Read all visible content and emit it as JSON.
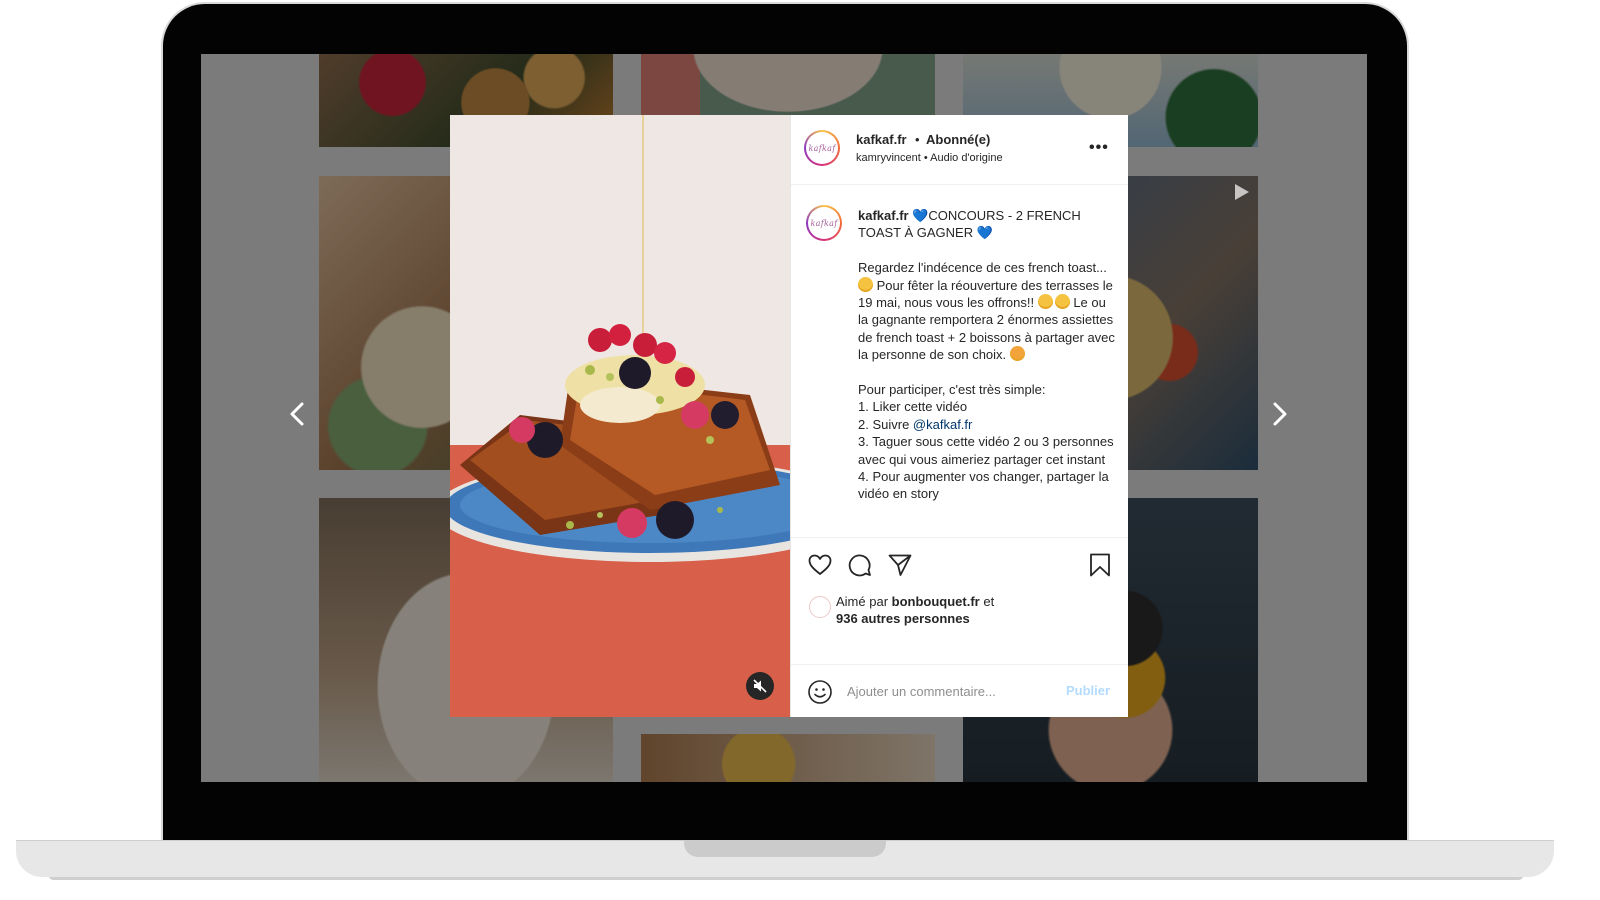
{
  "post": {
    "username": "kafkaf.fr",
    "separator": "•",
    "follow_status": "Abonné(e)",
    "subtitle": "kamryvincent • Audio d'origine",
    "more_label": "•••",
    "avatar_text": "kafkaf"
  },
  "caption": {
    "username": "kafkaf.fr",
    "heart": "💙",
    "title": "CONCOURS - 2 FRENCH TOAST À GAGNER",
    "para1_a": "Regardez l'indécence de ces french toast...",
    "para1_b": "Pour fêter la réouverture des terrasses le 19 mai, nous vous les offrons!!",
    "para1_c": "Le ou la gagnante remportera 2 énormes assiettes de french toast + 2 boissons à partager avec la personne de son choix.",
    "intro": "Pour participer, c'est très simple:",
    "step1": "1. Liker cette vidéo",
    "step2_prefix": "2. Suivre ",
    "step2_mention": "@kafkaf.fr",
    "step3": "3. Taguer sous cette vidéo 2 ou 3 personnes avec qui vous aimeriez partager cet instant",
    "step4": "4. Pour augmenter vos changer, partager la vidéo en story"
  },
  "likes": {
    "prefix": "Aimé par ",
    "user": "bonbouquet.fr",
    "middle": " et ",
    "others": "936 autres personnes"
  },
  "comment": {
    "placeholder": "Ajouter un commentaire...",
    "publish_label": "Publier"
  },
  "colors": {
    "text": "#262626",
    "mention": "#00376b",
    "publish_disabled": "#b3dbff",
    "caption_heart": "#1e73d8"
  },
  "icons": [
    "chevron-left-icon",
    "chevron-right-icon",
    "mute-icon",
    "more-icon",
    "heart-icon",
    "comment-icon",
    "share-icon",
    "bookmark-icon",
    "emoji-icon",
    "play-icon"
  ]
}
